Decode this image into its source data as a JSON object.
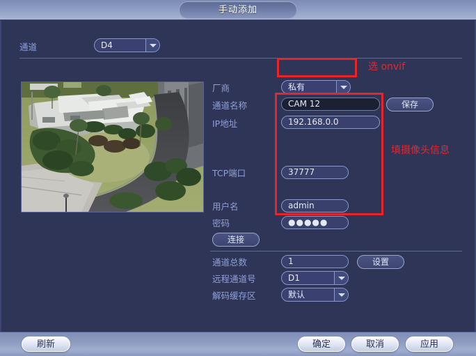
{
  "window": {
    "title": "手动添加"
  },
  "channel_row": {
    "label": "通道",
    "value": "D4"
  },
  "form": {
    "manufacturer": {
      "label": "厂商",
      "value": "私有"
    },
    "channel_name": {
      "label": "通道名称",
      "value": "CAM 12"
    },
    "ip_address": {
      "label": "IP地址",
      "value": "192.168.0.0"
    },
    "tcp_port": {
      "label": "TCP端口",
      "value": "37777"
    },
    "username": {
      "label": "用户名",
      "value": "admin"
    },
    "password": {
      "label": "密码",
      "value": "●●●●●"
    },
    "save_button": "保存",
    "connect_button": "连接"
  },
  "form2": {
    "total_channels": {
      "label": "通道总数",
      "value": "1"
    },
    "remote_channel": {
      "label": "远程通道号",
      "value": "D1"
    },
    "decode_buffer": {
      "label": "解码缓存区",
      "value": "默认"
    },
    "setup_button": "设置"
  },
  "annotations": {
    "select_onvif": "选 onvif",
    "fill_camera_info": "填摄像头信息"
  },
  "footer": {
    "refresh": "刷新",
    "ok": "确定",
    "cancel": "取消",
    "apply": "应用"
  },
  "colors": {
    "background": "#2f3557",
    "label_text": "#8f9fd8",
    "annotation_red": "#e8262c",
    "titlebar": "#8d9cc2"
  }
}
